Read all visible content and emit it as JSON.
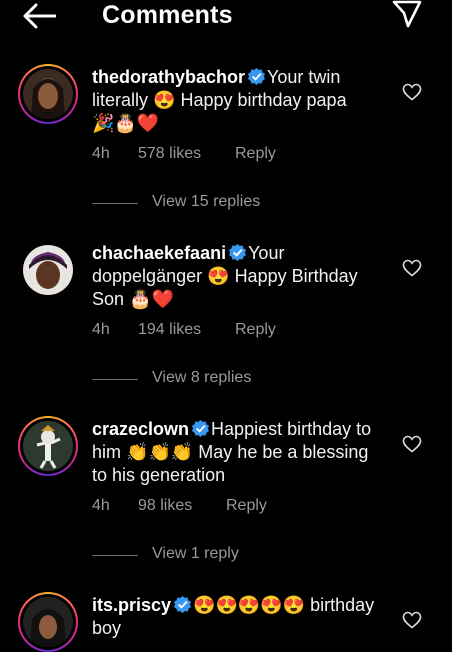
{
  "header": {
    "title": "Comments",
    "back_icon": "arrow-left-icon",
    "send_icon": "send-icon"
  },
  "colors": {
    "background": "#000000",
    "secondary_text": "#9a9a9a",
    "verified": "#3897f0",
    "heart": "#e0102f"
  },
  "comments": [
    {
      "username": "thedorathybachor",
      "verified": true,
      "text_1": "Your twin literally",
      "emoji_1": "😍",
      "text_2": "Happy birthday papa",
      "emoji_2": "🎉🎂❤️",
      "time": "4h",
      "likes": "578 likes",
      "reply": "Reply",
      "view_replies": "View 15 replies"
    },
    {
      "username": "chachaekefaani",
      "verified": true,
      "text_1": "Your doppelgänger",
      "emoji_1": "😍",
      "text_2": "Happy Birthday Son",
      "emoji_2": "🎂❤️",
      "time": "4h",
      "likes": "194 likes",
      "reply": "Reply",
      "view_replies": "View 8 replies"
    },
    {
      "username": "crazeclown",
      "verified": true,
      "text_1": "Happiest birthday to him",
      "emoji_1": "👏👏👏",
      "text_2": "May he be a blessing to his generation",
      "emoji_2": "",
      "time": "4h",
      "likes": "98 likes",
      "reply": "Reply",
      "view_replies": "View 1 reply"
    },
    {
      "username": "its.priscy",
      "verified": true,
      "text_1": "",
      "emoji_1": "😍😍😍😍😍",
      "text_2": "birthday boy",
      "emoji_2": ""
    }
  ]
}
